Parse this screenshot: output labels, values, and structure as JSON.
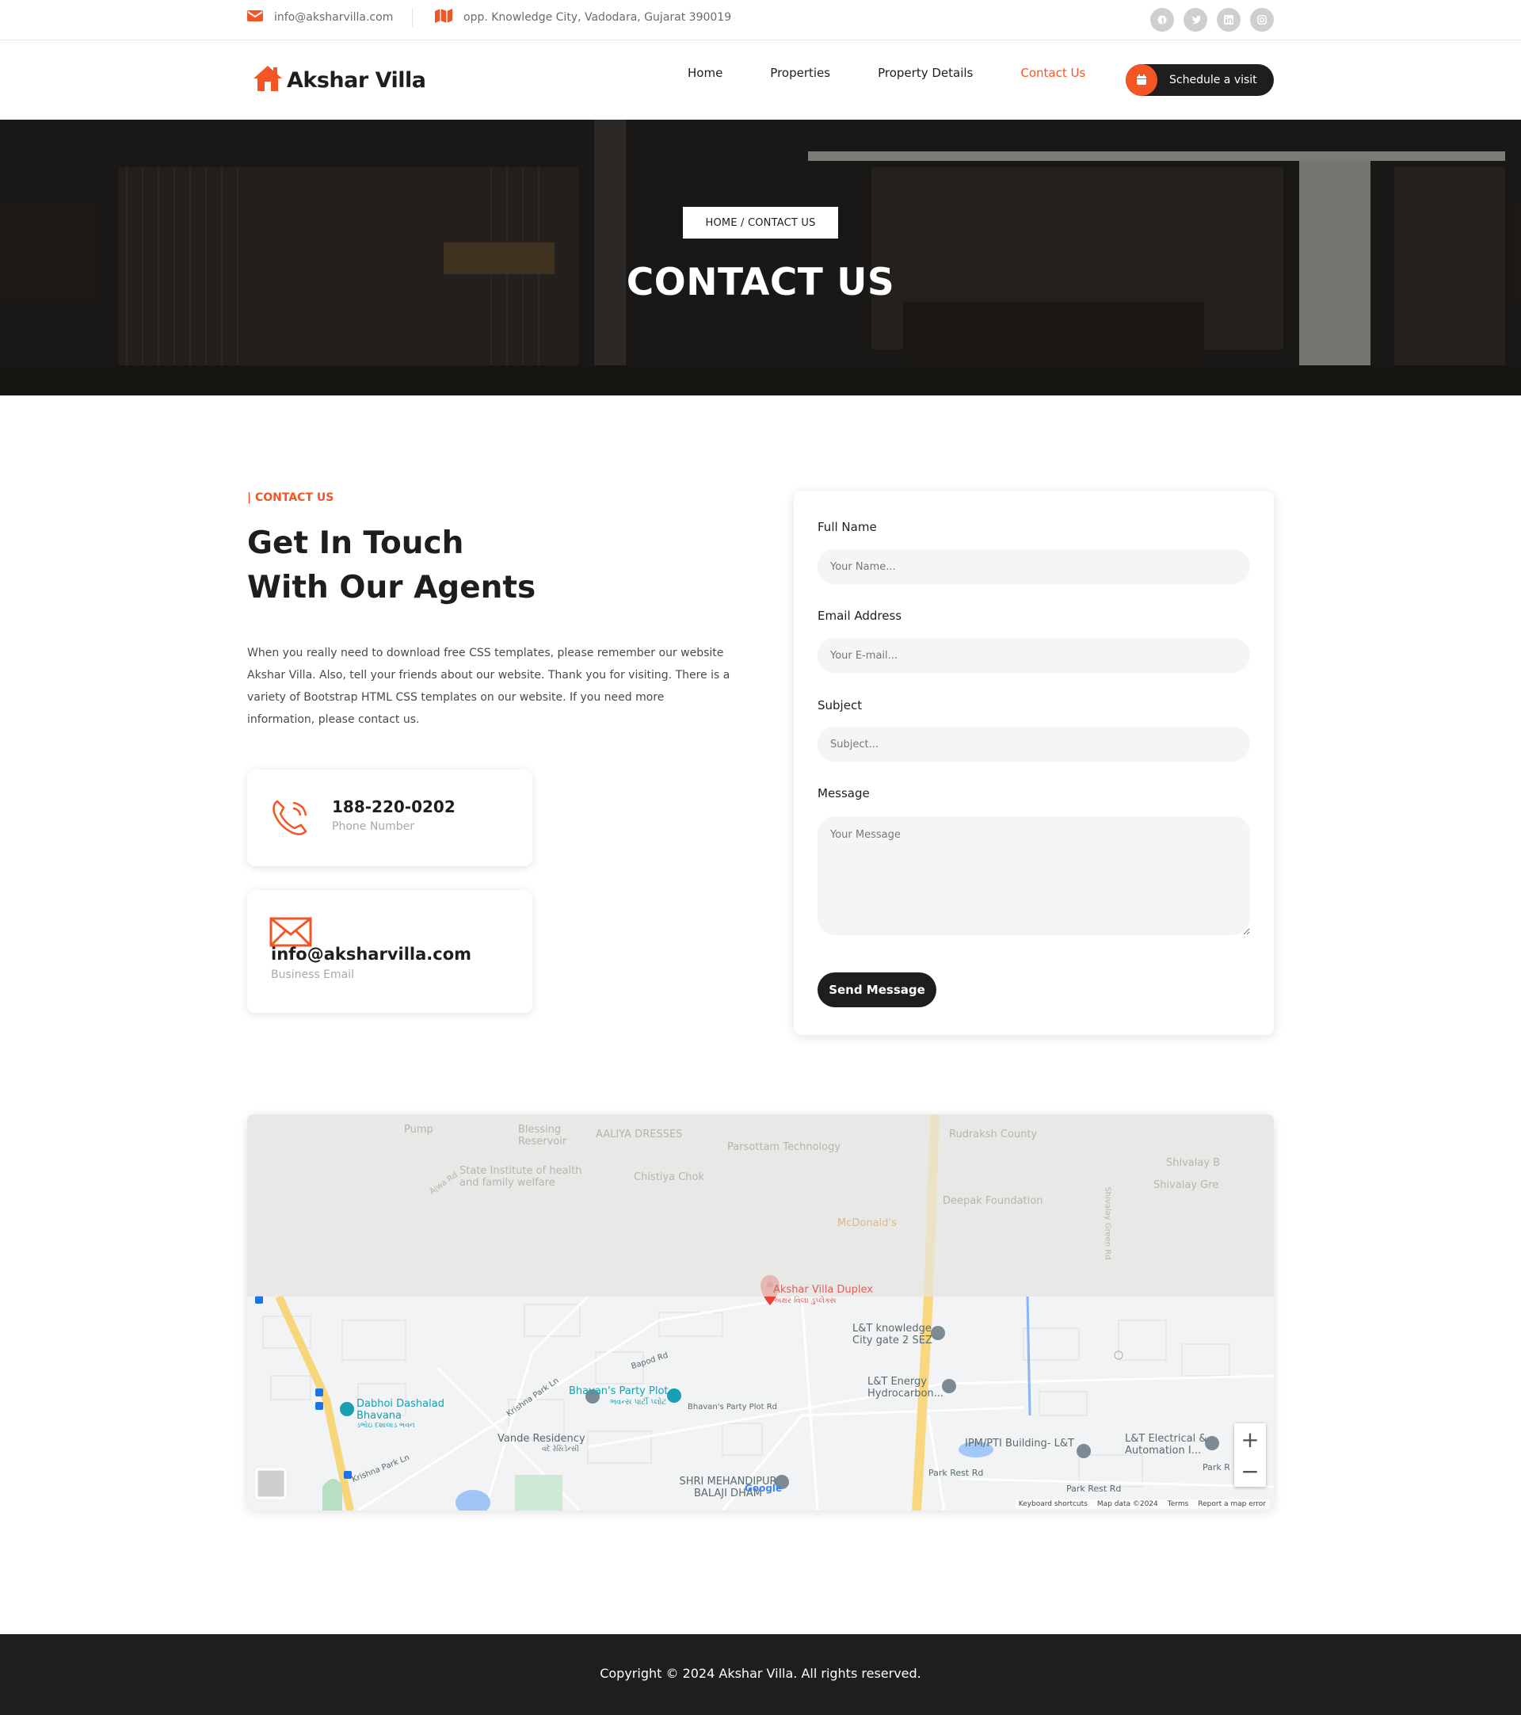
{
  "topbar": {
    "email": "info@aksharvilla.com",
    "address": "opp. Knowledge City, Vadodara, Gujarat 390019",
    "socials": [
      "facebook-icon",
      "twitter-icon",
      "linkedin-icon",
      "instagram-icon"
    ]
  },
  "header": {
    "logo_text": "Akshar Villa",
    "nav": [
      "Home",
      "Properties",
      "Property Details",
      "Contact Us"
    ],
    "active_nav": "Contact Us",
    "cta_label": "Schedule a visit"
  },
  "hero": {
    "breadcrumb": "HOME / CONTACT US",
    "title": "CONTACT US"
  },
  "contact": {
    "eyebrow": "| CONTACT US",
    "headline_line1": "Get In Touch",
    "headline_line2": "With Our Agents",
    "description": "When you really need to download free CSS templates, please remember our website Akshar Villa. Also, tell your friends about our website. Thank you for visiting. There is a variety of Bootstrap HTML CSS templates on our website. If you need more information, please contact us.",
    "phone": {
      "value": "188-220-0202",
      "label": "Phone Number"
    },
    "email": {
      "value": "info@aksharvilla.com",
      "label": "Business Email"
    }
  },
  "form": {
    "name_label": "Full Name",
    "name_placeholder": "Your Name...",
    "email_label": "Email Address",
    "email_placeholder": "Your E-mail...",
    "subject_label": "Subject",
    "subject_placeholder": "Subject...",
    "message_label": "Message",
    "message_placeholder": "Your Message",
    "submit_label": "Send Message"
  },
  "map": {
    "labels": {
      "pump": "Pump",
      "blessing": "Blessing Reservoir",
      "aaliya": "AALIYA DRESSES",
      "parsottam": "Parsottam Technology",
      "rudraksh": "Rudraksh County",
      "state_inst": "State Institute of health and family welfare",
      "chistiya": "Chistiya Chok",
      "ajwa": "Ajwa Rd",
      "deepak": "Deepak Foundation",
      "mcd": "McDonald's",
      "shivalay1": "Shivalay B",
      "shivalay2": "Shivalay Gre",
      "shivalay_rd": "Shivalay Green Rd",
      "akshar": "Akshar Villa Duplex",
      "akshar_gu": "અક્ષર વિલા ડુપ્લેક્સ",
      "lt_gate": "L&T knowledge City gate 2 SEZ",
      "bapod": "Bapod Rd",
      "lt_energy": "L&T Energy Hydrocarbon...",
      "krishna_park_ln": "Krishna Park Ln",
      "bhavans_pp": "Bhavan's Party Plot",
      "bhavans_gu": "ભવન્સ પાર્ટી પ્લોટ",
      "bhavans_rd": "Bhavan's Party Plot Rd",
      "dabhoi": "Dabhoi Dashalad Bhavana",
      "dabhoi_gu": "ડભોઇ દશાલાડ ભવન",
      "vande": "Vande Residency",
      "vande_gu": "વંદે રેસિડેન્સી",
      "krishna_park_ln2": "Krishna Park Ln",
      "ipm": "IPM/PTI Building- L&T",
      "lt_elec": "L&T Electrical & Automation I...",
      "park_rest1": "Park Rest Rd",
      "park_rest2": "Park Rest Rd",
      "park_r": "Park R",
      "mehandipur": "SHRI MEHANDIPUR BALAJI DHAM",
      "google": "Google"
    },
    "zoom_in": "+",
    "zoom_out": "−",
    "footer_items": [
      "Keyboard shortcuts",
      "Map data ©2024",
      "Terms",
      "Report a map error"
    ]
  },
  "footer": {
    "copyright": "Copyright © 2024 Akshar Villa. All rights reserved."
  },
  "colors": {
    "accent": "#f35525",
    "dark": "#1e1e1e",
    "input_bg": "#f5f5f5"
  }
}
